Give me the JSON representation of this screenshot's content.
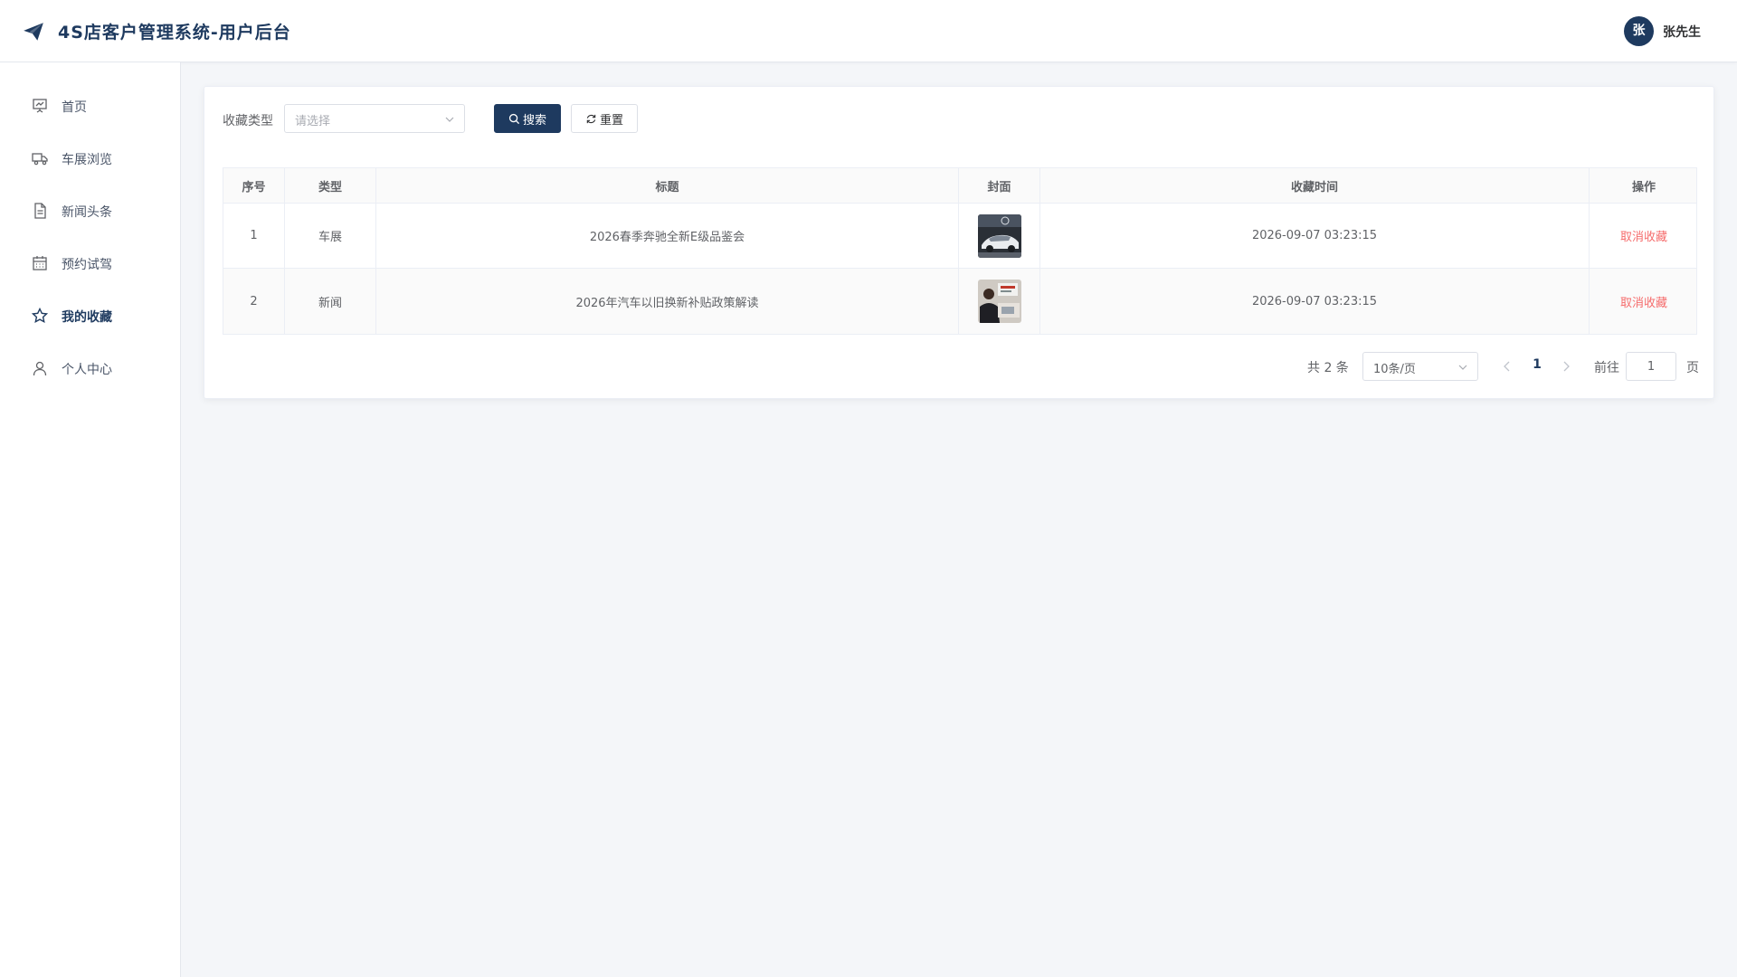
{
  "header": {
    "app_title": "4S店客户管理系统-用户后台",
    "avatar_char": "张",
    "username": "张先生"
  },
  "sidebar": {
    "items": [
      {
        "label": "首页",
        "icon": "presentation-icon",
        "active": false
      },
      {
        "label": "车展浏览",
        "icon": "truck-icon",
        "active": false
      },
      {
        "label": "新闻头条",
        "icon": "document-icon",
        "active": false
      },
      {
        "label": "预约试驾",
        "icon": "calendar-icon",
        "active": false
      },
      {
        "label": "我的收藏",
        "icon": "star-icon",
        "active": true
      },
      {
        "label": "个人中心",
        "icon": "user-icon",
        "active": false
      }
    ]
  },
  "filter": {
    "label": "收藏类型",
    "select_placeholder": "请选择",
    "search_label": "搜索",
    "reset_label": "重置"
  },
  "table": {
    "columns": [
      "序号",
      "类型",
      "标题",
      "封面",
      "收藏时间",
      "操作"
    ],
    "rows": [
      {
        "index": "1",
        "type": "车展",
        "title": "2026春季奔驰全新E级品鉴会",
        "cover": "car-photo",
        "time": "2026-09-07 03:23:15",
        "action": "取消收藏"
      },
      {
        "index": "2",
        "type": "新闻",
        "title": "2026年汽车以旧换新补贴政策解读",
        "cover": "news-photo",
        "time": "2026-09-07 03:23:15",
        "action": "取消收藏"
      }
    ]
  },
  "pagination": {
    "total_text": "共 2 条",
    "page_size": "10条/页",
    "current_page": "1",
    "goto_label": "前往",
    "goto_value": "1",
    "goto_suffix": "页"
  },
  "colors": {
    "primary": "#1e3a5f",
    "danger": "#f56c6c"
  }
}
